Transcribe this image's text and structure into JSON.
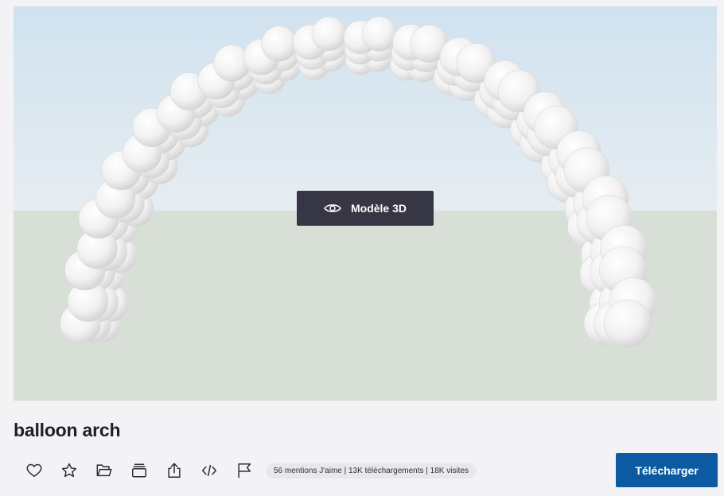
{
  "model": {
    "title": "balloon arch"
  },
  "viewer": {
    "view_3d_label": "Modèle 3D"
  },
  "actions": [
    {
      "icon": "heart-icon"
    },
    {
      "icon": "star-icon"
    },
    {
      "icon": "folder-icon"
    },
    {
      "icon": "collection-icon"
    },
    {
      "icon": "share-icon"
    },
    {
      "icon": "embed-code-icon"
    },
    {
      "icon": "flag-icon"
    }
  ],
  "stats": {
    "text": "56 mentions J'aime | 13K téléchargements | 18K visites"
  },
  "download": {
    "label": "Télécharger"
  },
  "colors": {
    "sky_top": "#d0e2ef",
    "sky_bottom": "#e6edf2",
    "ground": "#d7dfd6",
    "balloon": "#f4f4f4",
    "button_dark": "#363645",
    "download_blue": "#0b5aa2"
  }
}
